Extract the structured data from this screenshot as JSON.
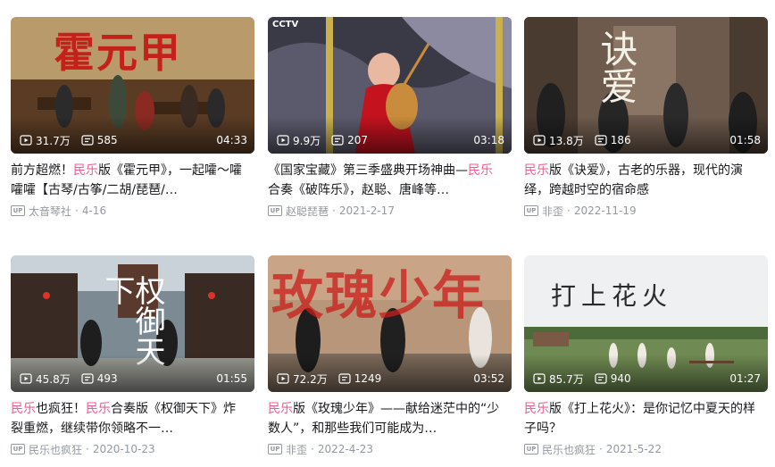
{
  "colors": {
    "highlight": "#f25d8e",
    "meta": "#9499a0",
    "title": "#18191c"
  },
  "cards": [
    {
      "views": "31.7万",
      "danmaku": "585",
      "duration": "04:33",
      "title_pre": "前方超燃！",
      "title_tag": "民乐",
      "title_mid": "版《霍元甲》，一起嚯～嚯嚯嚯【古琴/古筝/二胡/琵琶/…",
      "title_tag2": "",
      "title_post": "",
      "author": "太音琴社",
      "date": "4-16",
      "overlay_text": "霍元甲"
    },
    {
      "views": "9.9万",
      "danmaku": "207",
      "duration": "03:18",
      "title_pre": "《国家宝藏》第三季盛典开场神曲—",
      "title_tag": "民乐",
      "title_mid": "合奏《破阵乐》，赵聪、唐峰等…",
      "title_tag2": "",
      "title_post": "",
      "author": "赵聪琵琶",
      "date": "2021-2-17",
      "overlay_text": "CCTV"
    },
    {
      "views": "13.8万",
      "danmaku": "186",
      "duration": "01:58",
      "title_pre": "",
      "title_tag": "民乐",
      "title_mid": "版《诀爱》，古老的乐器，现代的演绎，跨越时空的宿命感",
      "title_tag2": "",
      "title_post": "",
      "author": "非歪",
      "date": "2022-11-19",
      "overlay_text": "诀爱"
    },
    {
      "views": "45.8万",
      "danmaku": "493",
      "duration": "01:55",
      "title_pre": "",
      "title_tag": "民乐",
      "title_mid": "也疯狂！",
      "title_tag2": "民乐",
      "title_post": "合奏版《权御天下》炸裂重燃，继续带你领略不一…",
      "author": "民乐也疯狂",
      "date": "2020-10-23",
      "overlay_text": "权御天下"
    },
    {
      "views": "72.2万",
      "danmaku": "1249",
      "duration": "03:52",
      "title_pre": "",
      "title_tag": "民乐",
      "title_mid": "版《玫瑰少年》——献给迷茫中的“少数人”，和那些我们可能成为…",
      "title_tag2": "",
      "title_post": "",
      "author": "非歪",
      "date": "2022-4-23",
      "overlay_text": "玫瑰少年"
    },
    {
      "views": "85.7万",
      "danmaku": "940",
      "duration": "01:27",
      "title_pre": "",
      "title_tag": "民乐",
      "title_mid": "版《打上花火》：是你记忆中夏天的样子吗？",
      "title_tag2": "",
      "title_post": "",
      "author": "民乐也疯狂",
      "date": "2021-5-22",
      "overlay_text": "打上花火"
    }
  ],
  "up_badge": "UP"
}
